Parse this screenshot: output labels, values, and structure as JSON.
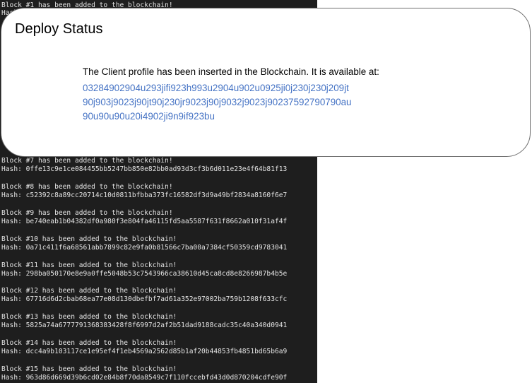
{
  "terminal": {
    "top_lines": [
      "Block #1 has been added to the blockchain!",
      "Hash:"
    ],
    "blocks": [
      {
        "added": "Block #7 has been added to the blockchain!",
        "hash": "Hash: 0ffe13c9e1ce084455bb5247bb850e82bb0ad93d3cf3b6d011e23e4f64b81f13"
      },
      {
        "added": "Block #8 has been added to the blockchain!",
        "hash": "Hash: c52392c8a89cc20714c10d0811bfbba373fc16582df3d9a49bf2834a8160f6e7"
      },
      {
        "added": "Block #9 has been added to the blockchain!",
        "hash": "Hash: be740eab1b04382df0a980f3e804fa46115fd5aa5587f631f8662a010f31af4f"
      },
      {
        "added": "Block #10 has been added to the blockchain!",
        "hash": "Hash: 0a71c411f6a68561abb7899c82e9fa0b81566c7ba00a7384cf50359cd9783041"
      },
      {
        "added": "Block #11 has been added to the blockchain!",
        "hash": "Hash: 298ba050170e8e9a0ffe5048b53c7543966ca38610d45ca8cd8e8266987b4b5e"
      },
      {
        "added": "Block #12 has been added to the blockchain!",
        "hash": "Hash: 67716d6d2cbab68ea77e08d130dbefbf7ad61a352e97002ba759b1208f633cfc"
      },
      {
        "added": "Block #13 has been added to the blockchain!",
        "hash": "Hash: 5825a74a6777791368383428f8f6997d2af2b51dad9188cadc35c40a340d0941"
      },
      {
        "added": "Block #14 has been added to the blockchain!",
        "hash": "Hash: dcc4a9b103117ce1e95ef4f1eb4569a2562d85b1af20b44853fb4851bd65b6a9"
      },
      {
        "added": "Block #15 has been added to the blockchain!",
        "hash": "Hash: 963d86d669d39b6cd02e84b8f70da8549c7f110fccebfd43d0d870204cdfe90f"
      }
    ]
  },
  "dialog": {
    "title": "Deploy Status",
    "message": "The Client profile has been inserted in the Blockchain. It is available at:",
    "link_lines": [
      "03284902904u293jifi923h993u2904u902u0925ji0j230j230j209jt",
      "90j903j9023j90jt90j230jr9023j90j9032j9023j90237592790790au",
      "90u90u90u20i4902ji9n9if923bu"
    ]
  },
  "colors": {
    "terminal_bg": "#1e1e1e",
    "terminal_text": "#e4e4e4",
    "link": "#4472c4",
    "dialog_border": "#6f6f6f"
  }
}
